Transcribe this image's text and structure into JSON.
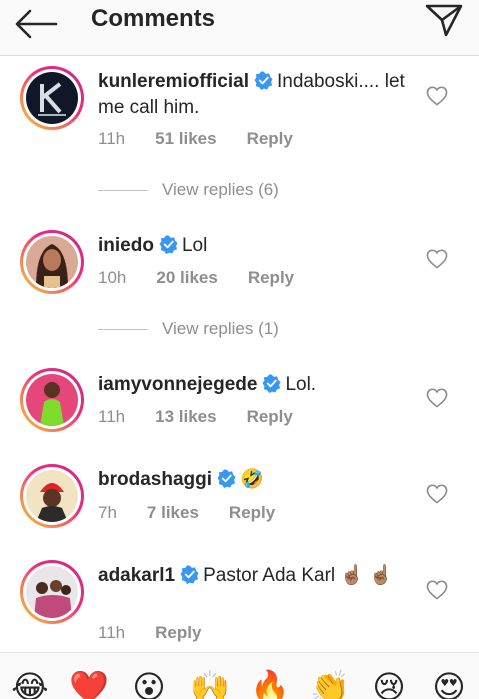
{
  "header": {
    "title": "Comments",
    "back_icon": "arrow-left-icon",
    "send_icon": "paper-plane-icon"
  },
  "comments": [
    {
      "username": "kunleremiofficial",
      "verified": true,
      "text": "Indaboski.... let me call him.",
      "time": "11h",
      "likes": "51 likes",
      "reply": "Reply",
      "view_replies": "View replies (6)"
    },
    {
      "username": "iniedo",
      "verified": true,
      "text": "Lol",
      "time": "10h",
      "likes": "20 likes",
      "reply": "Reply",
      "view_replies": "View replies (1)"
    },
    {
      "username": "iamyvonnejegede",
      "verified": true,
      "text": "Lol.",
      "time": "11h",
      "likes": "13 likes",
      "reply": "Reply"
    },
    {
      "username": "brodashaggi",
      "verified": true,
      "text": "🤣",
      "time": "7h",
      "likes": "7 likes",
      "reply": "Reply"
    },
    {
      "username": "adakarl1",
      "verified": true,
      "text": "Pastor Ada Karl ☝🏽 ☝🏽",
      "time": "11h",
      "reply": "Reply"
    }
  ],
  "emoji_bar": [
    "😂",
    "❤️",
    "😮",
    "🙌",
    "🔥",
    "👏",
    "😢",
    "😍"
  ],
  "colors": {
    "verified": "#3897f0",
    "meta": "#8e8e8e",
    "text": "#262626",
    "ring_start": "#f9ce34",
    "ring_end": "#c62a8d"
  }
}
